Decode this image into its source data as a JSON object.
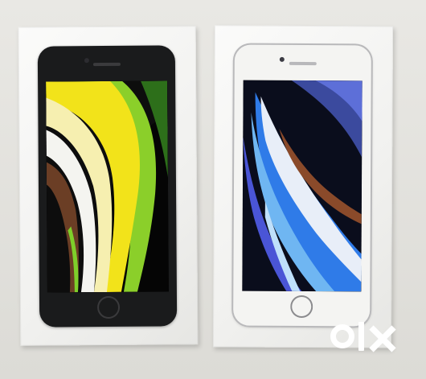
{
  "scene": {
    "background_color": "#e4e3df",
    "boxes": [
      {
        "phone_color": "black",
        "wallpaper": "yellow-green-white-swirl",
        "accent": "#f2e31a"
      },
      {
        "phone_color": "white",
        "wallpaper": "blue-white-swirl",
        "accent": "#2f7be8"
      }
    ]
  },
  "watermark": {
    "text": "olx",
    "icon": "olx-logo-icon",
    "color": "#ffffff"
  }
}
